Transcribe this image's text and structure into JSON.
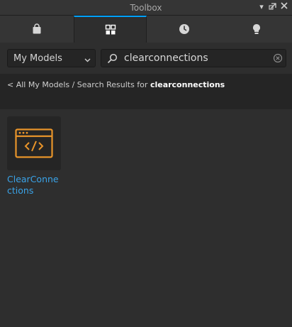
{
  "window": {
    "title": "Toolbox",
    "controls": [
      "chevron-down-icon",
      "close-icon",
      "undock-icon",
      "close-x-icon"
    ]
  },
  "tabs": [
    {
      "icon": "shopping-bag-icon",
      "active": false
    },
    {
      "icon": "inventory-grid-icon",
      "active": true
    },
    {
      "icon": "recent-clock-icon",
      "active": false
    },
    {
      "icon": "lightbulb-icon",
      "active": false
    }
  ],
  "filter": {
    "category": "My Models",
    "search_value": "clearconnections"
  },
  "breadcrumb": {
    "back": "< All My Models",
    "separator": " / Search Results for ",
    "query": "clearconnections"
  },
  "results": [
    {
      "name": "ClearConnections",
      "icon": "script-code-icon",
      "icon_color": "#e8942a"
    }
  ],
  "colors": {
    "accent": "#00a2ff",
    "link": "#3aa3e8",
    "asset_icon": "#e8942a"
  }
}
